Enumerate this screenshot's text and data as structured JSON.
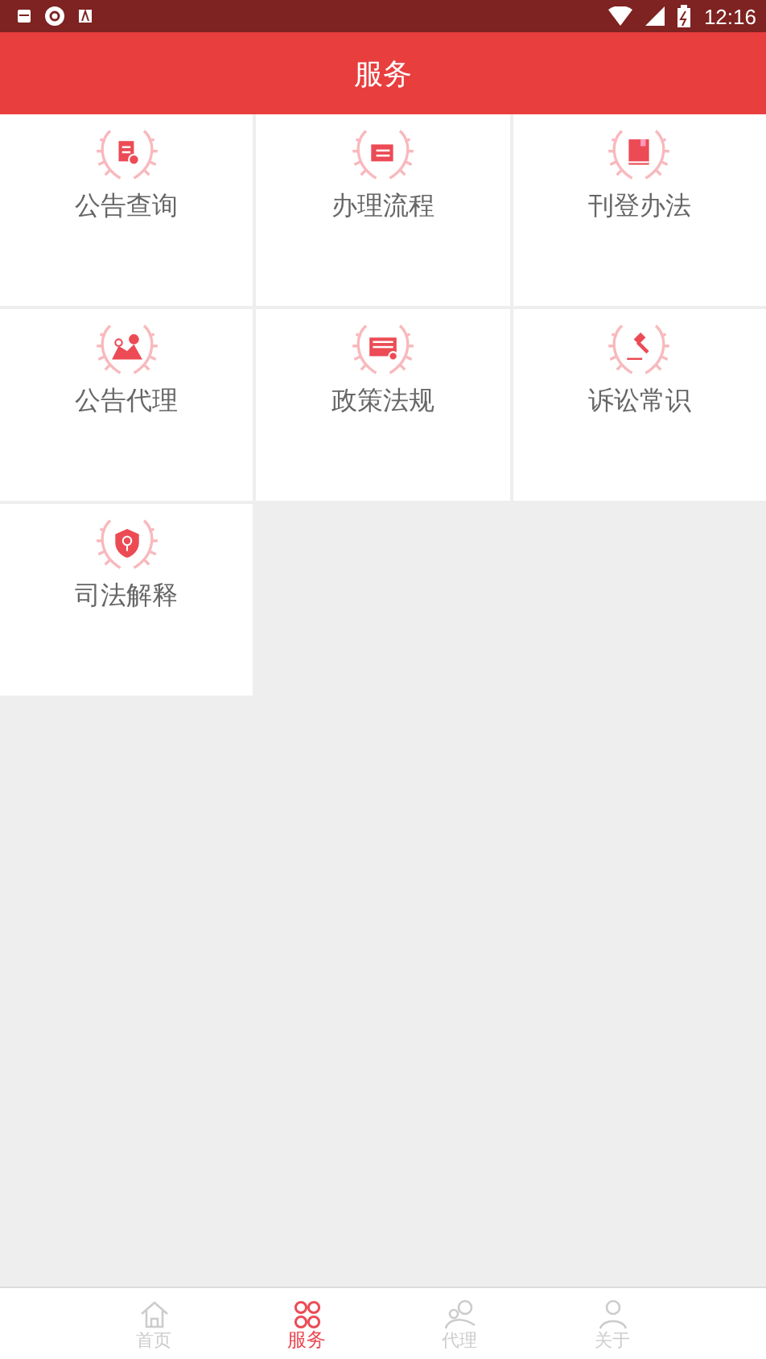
{
  "status_bar": {
    "time": "12:16"
  },
  "header": {
    "title": "服务"
  },
  "services": [
    {
      "label": "公告查询",
      "kind": "notice"
    },
    {
      "label": "办理流程",
      "kind": "flow"
    },
    {
      "label": "刊登办法",
      "kind": "book"
    },
    {
      "label": "公告代理",
      "kind": "map"
    },
    {
      "label": "政策法规",
      "kind": "news"
    },
    {
      "label": "诉讼常识",
      "kind": "gavel"
    },
    {
      "label": "司法解释",
      "kind": "shield"
    }
  ],
  "tab_bar": [
    {
      "label": "首页",
      "kind": "home",
      "selected": false
    },
    {
      "label": "服务",
      "kind": "grid",
      "selected": true
    },
    {
      "label": "代理",
      "kind": "people",
      "selected": false
    },
    {
      "label": "关于",
      "kind": "person",
      "selected": false
    }
  ]
}
